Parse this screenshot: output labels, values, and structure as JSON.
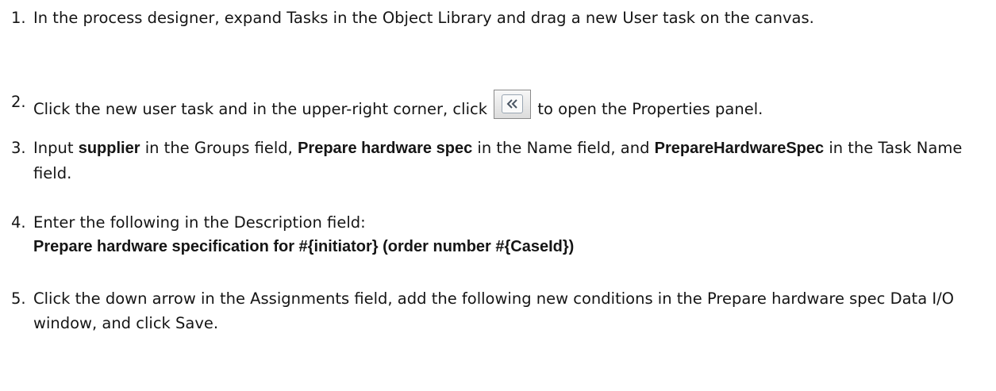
{
  "steps": [
    {
      "number": "1.",
      "parts": [
        "In the process designer, expand ",
        "Tasks",
        " in the ",
        "Object Library",
        " and drag a new ",
        "User",
        " task on the canvas."
      ]
    },
    {
      "number": "2.",
      "parts": [
        "Click the new user task and in the upper-right corner, click ",
        " to open the ",
        "Properties",
        " panel."
      ],
      "icon": "double-chevron-left-icon"
    },
    {
      "number": "3.",
      "parts": [
        "Input ",
        "supplier",
        " in the ",
        "Groups",
        " field, ",
        "Prepare hardware spec",
        " in the ",
        "Name",
        " field, and ",
        "PrepareHardwareSpec",
        " in the ",
        "Task Name",
        " field."
      ]
    },
    {
      "number": "4.",
      "parts": [
        "Enter the following in the ",
        "Description",
        " field:"
      ],
      "code": "Prepare hardware specification for #{initiator} (order number #{CaseId})"
    },
    {
      "number": "5.",
      "parts": [
        "Click the down arrow in the ",
        "Assignments",
        " field, add the following new conditions in the ",
        "Prepare hardware spec Data I/O",
        " window, and click ",
        "Save",
        "."
      ]
    }
  ]
}
